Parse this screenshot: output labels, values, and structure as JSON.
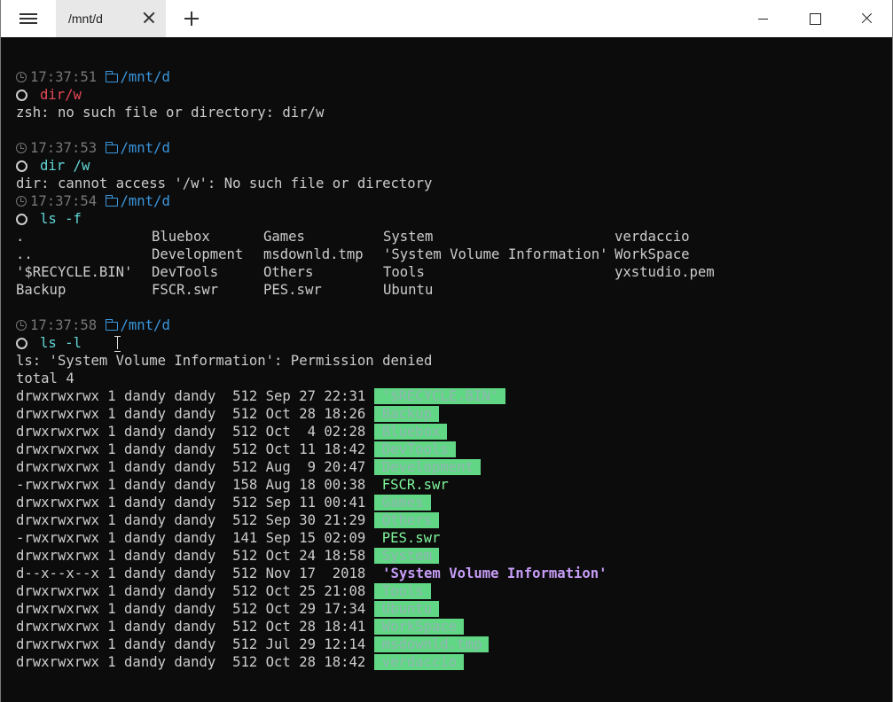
{
  "window": {
    "tab_title": "/mnt/d"
  },
  "colors": {
    "background": "#0c0c0c",
    "text": "#cccccc",
    "prompt_time": "#767676",
    "prompt_path": "#3a96dd",
    "command_error": "#e74856",
    "command_ok": "#61d6d6",
    "dir_highlight_bg": "#61d685",
    "exec_file": "#7ff59a",
    "special_dir": "#c79df7"
  },
  "blocks": [
    {
      "time": "17:37:51",
      "path": "/mnt/d",
      "command": "dir/w",
      "status": "error",
      "output": [
        "zsh: no such file or directory: dir/w"
      ]
    },
    {
      "time": "17:37:53",
      "path": "/mnt/d",
      "command": "dir /w",
      "status": "ok",
      "output": [
        "dir: cannot access '/w': No such file or directory"
      ]
    },
    {
      "time": "17:37:54",
      "path": "/mnt/d",
      "command": "ls -f",
      "status": "ok",
      "grid": [
        [
          ".",
          "Bluebox",
          "Games",
          "System",
          "verdaccio"
        ],
        [
          "..",
          "Development",
          "msdownld.tmp",
          "'System Volume Information'",
          "WorkSpace"
        ],
        [
          "'$RECYCLE.BIN'",
          "DevTools",
          "Others",
          "Tools",
          "yxstudio.pem"
        ],
        [
          "Backup",
          "FSCR.swr",
          "PES.swr",
          "Ubuntu",
          ""
        ]
      ]
    },
    {
      "time": "17:37:58",
      "path": "/mnt/d",
      "command": "ls -l",
      "status": "ok",
      "output": [
        "ls: 'System Volume Information': Permission denied",
        "total 4"
      ],
      "listing": [
        {
          "info": "drwxrwxrwx 1 dandy dandy  512 Sep 27 22:31",
          "name": "'$RECYCLE.BIN'",
          "kind": "dir"
        },
        {
          "info": "drwxrwxrwx 1 dandy dandy  512 Oct 28 18:26",
          "name": "Backup",
          "kind": "dir"
        },
        {
          "info": "drwxrwxrwx 1 dandy dandy  512 Oct  4 02:28",
          "name": "Bluebox",
          "kind": "dir"
        },
        {
          "info": "drwxrwxrwx 1 dandy dandy  512 Oct 11 18:42",
          "name": "DevTools",
          "kind": "dir"
        },
        {
          "info": "drwxrwxrwx 1 dandy dandy  512 Aug  9 20:47",
          "name": "Development",
          "kind": "dir"
        },
        {
          "info": "-rwxrwxrwx 1 dandy dandy  158 Aug 18 00:38",
          "name": "FSCR.swr",
          "kind": "exec"
        },
        {
          "info": "drwxrwxrwx 1 dandy dandy  512 Sep 11 00:41",
          "name": "Games",
          "kind": "dir"
        },
        {
          "info": "drwxrwxrwx 1 dandy dandy  512 Sep 30 21:29",
          "name": "Others",
          "kind": "dir"
        },
        {
          "info": "-rwxrwxrwx 1 dandy dandy  141 Sep 15 02:09",
          "name": "PES.swr",
          "kind": "exec"
        },
        {
          "info": "drwxrwxrwx 1 dandy dandy  512 Oct 24 18:58",
          "name": "System",
          "kind": "dir"
        },
        {
          "info": "d--x--x--x 1 dandy dandy  512 Nov 17  2018",
          "name": "'System Volume Information'",
          "kind": "special"
        },
        {
          "info": "drwxrwxrwx 1 dandy dandy  512 Oct 25 21:08",
          "name": "Tools",
          "kind": "dir"
        },
        {
          "info": "drwxrwxrwx 1 dandy dandy  512 Oct 29 17:34",
          "name": "Ubuntu",
          "kind": "dir"
        },
        {
          "info": "drwxrwxrwx 1 dandy dandy  512 Oct 28 18:41",
          "name": "WorkSpace",
          "kind": "dir"
        },
        {
          "info": "drwxrwxrwx 1 dandy dandy  512 Jul 29 12:14",
          "name": "msdownld.tmp",
          "kind": "dir"
        },
        {
          "info": "drwxrwxrwx 1 dandy dandy  512 Oct 28 18:42",
          "name": "verdaccio",
          "kind": "dir"
        }
      ]
    }
  ]
}
